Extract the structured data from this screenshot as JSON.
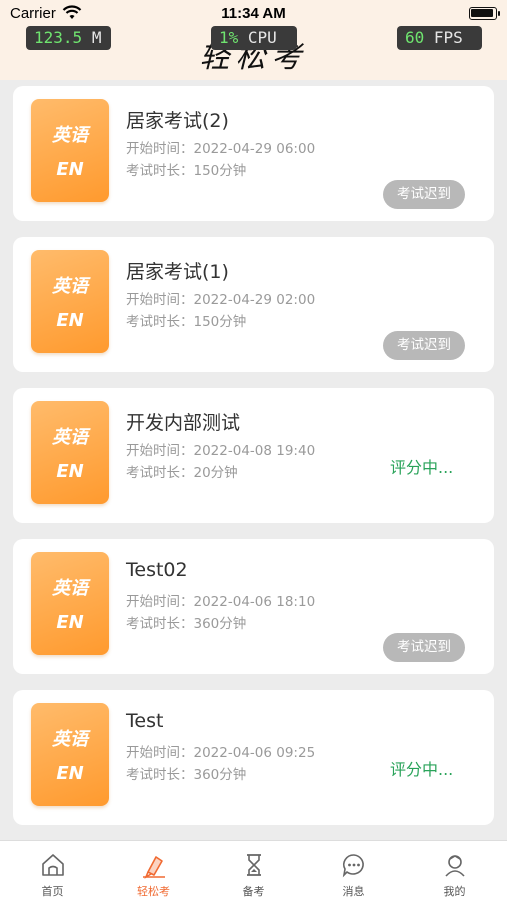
{
  "status_bar": {
    "carrier": "Carrier",
    "time": "11:34 AM"
  },
  "perf": {
    "memory": "123.5",
    "memory_unit": "M",
    "cpu": "1%",
    "cpu_label": "CPU",
    "fps": "60",
    "fps_label": "FPS"
  },
  "app_title": "轻松考",
  "colors": {
    "accent": "#f06a32",
    "tile": "#ff9f3a",
    "grading": "#2aa35a",
    "late_button": "#b8b8b8",
    "header_bg": "#fcf1e6"
  },
  "exams": [
    {
      "subject_cn": "英语",
      "subject_en": "EN",
      "title": "居家考试(2)",
      "start_label": "开始时间：",
      "start": "2022-04-29 06:00",
      "duration_label": "考试时长：",
      "duration": "150分钟",
      "status": "考试迟到",
      "status_kind": "late"
    },
    {
      "subject_cn": "英语",
      "subject_en": "EN",
      "title": "居家考试(1)",
      "start_label": "开始时间：",
      "start": "2022-04-29 02:00",
      "duration_label": "考试时长：",
      "duration": "150分钟",
      "status": "考试迟到",
      "status_kind": "late"
    },
    {
      "subject_cn": "英语",
      "subject_en": "EN",
      "title": "开发内部测试",
      "start_label": "开始时间：",
      "start": "2022-04-08 19:40",
      "duration_label": "考试时长：",
      "duration": "20分钟",
      "status": "评分中...",
      "status_kind": "grading"
    },
    {
      "subject_cn": "英语",
      "subject_en": "EN",
      "title": "Test02",
      "start_label": "开始时间：",
      "start": "2022-04-06 18:10",
      "duration_label": "考试时长：",
      "duration": "360分钟",
      "status": "考试迟到",
      "status_kind": "late"
    },
    {
      "subject_cn": "英语",
      "subject_en": "EN",
      "title": "Test",
      "start_label": "开始时间：",
      "start": "2022-04-06 09:25",
      "duration_label": "考试时长：",
      "duration": "360分钟",
      "status": "评分中...",
      "status_kind": "grading"
    }
  ],
  "tabs": [
    {
      "label": "首页",
      "icon": "home-icon"
    },
    {
      "label": "轻松考",
      "icon": "pen-icon",
      "active": true
    },
    {
      "label": "备考",
      "icon": "hourglass-icon"
    },
    {
      "label": "消息",
      "icon": "chat-icon"
    },
    {
      "label": "我的",
      "icon": "profile-icon"
    }
  ]
}
